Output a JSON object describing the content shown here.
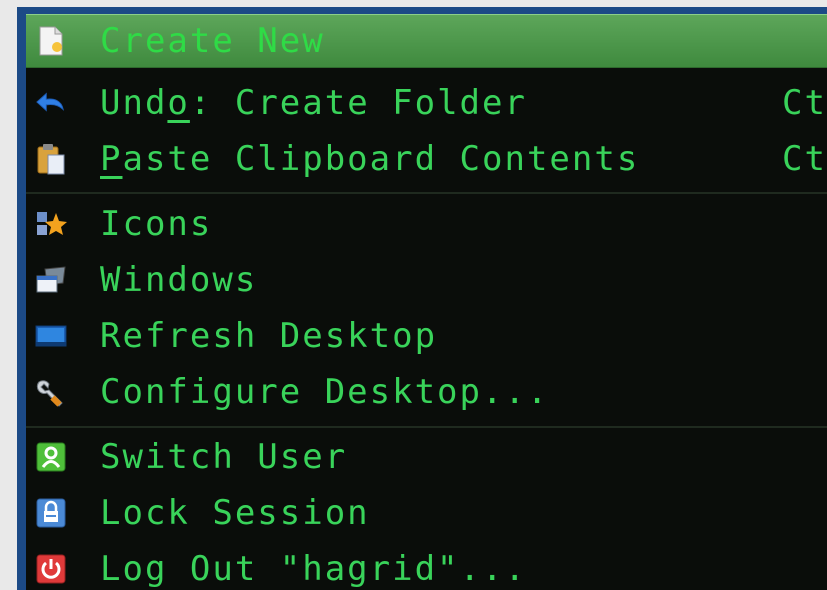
{
  "menu": {
    "items": [
      {
        "label": "Create New",
        "icon": "document-new-icon"
      },
      {
        "label_pre": "Und",
        "label_ul": "o",
        "label_post": ": Create Folder",
        "shortcut": "Ct",
        "icon": "undo-arrow-icon"
      },
      {
        "label_ul": "P",
        "label_post": "aste Clipboard Contents",
        "shortcut": "Ct",
        "icon": "clipboard-paste-icon"
      },
      {
        "label": "Icons",
        "icon": "icons-sparkle-icon"
      },
      {
        "label": "Windows",
        "icon": "windows-stack-icon"
      },
      {
        "label": "Refresh Desktop",
        "icon": "desktop-refresh-icon"
      },
      {
        "label": "Configure Desktop...",
        "icon": "wrench-icon"
      },
      {
        "label": "Switch User",
        "icon": "switch-user-icon"
      },
      {
        "label": "Lock Session",
        "icon": "lock-icon"
      },
      {
        "label": "Log Out \"hagrid\"...",
        "icon": "power-logout-icon"
      }
    ]
  },
  "colors": {
    "text": "#39d35a",
    "menu_bg": "#0a0d0a",
    "highlight": "#4f9a4c",
    "frame": "#1c4a86"
  }
}
